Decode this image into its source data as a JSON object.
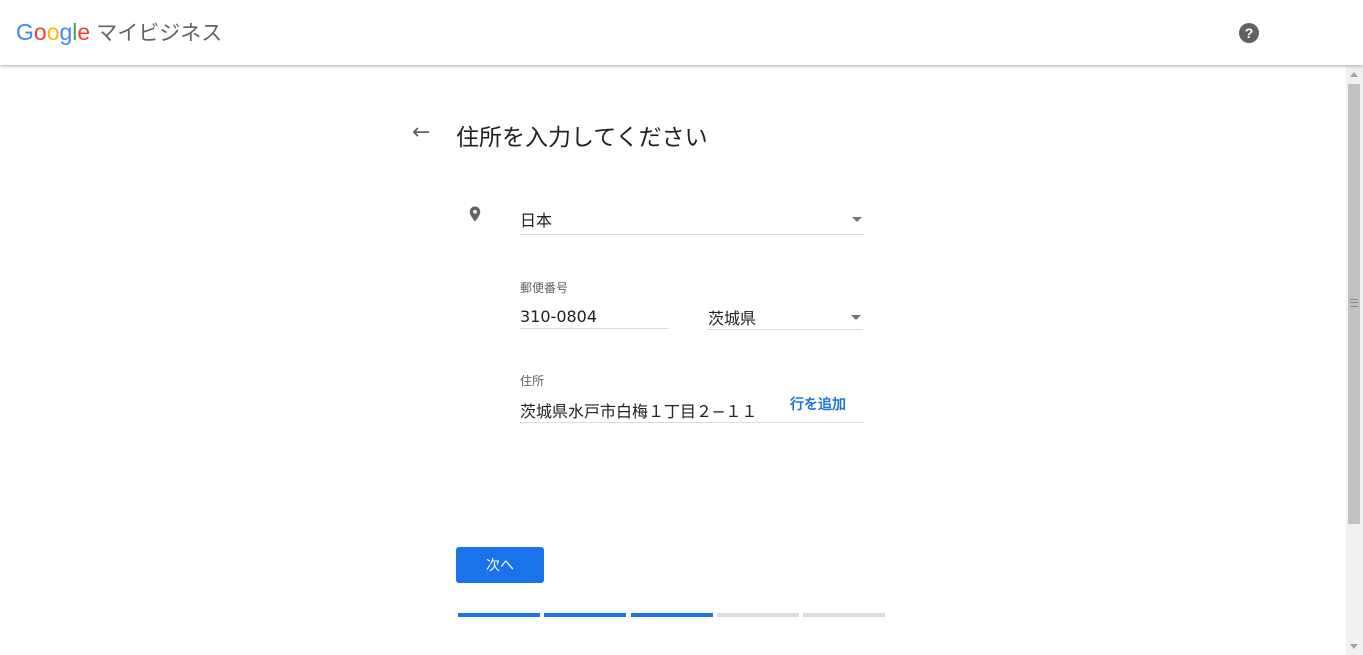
{
  "header": {
    "brand_letters": [
      {
        "ch": "G",
        "color": "#4285F4"
      },
      {
        "ch": "o",
        "color": "#EA4335"
      },
      {
        "ch": "o",
        "color": "#FBBC05"
      },
      {
        "ch": "g",
        "color": "#4285F4"
      },
      {
        "ch": "l",
        "color": "#34A853"
      },
      {
        "ch": "e",
        "color": "#EA4335"
      }
    ],
    "product": "マイビジネス",
    "help_glyph": "?"
  },
  "page": {
    "back_glyph": "←",
    "title": "住所を入力してください"
  },
  "form": {
    "country_value": "日本",
    "postal_label": "郵便番号",
    "postal_value": "310-0804",
    "prefecture_value": "茨城県",
    "address_label": "住所",
    "address_value": "茨城県水戸市白梅１丁目２−１１",
    "add_line_label": "行を追加"
  },
  "actions": {
    "next_label": "次へ"
  },
  "progress": {
    "total_steps": 5,
    "completed_steps": 3
  },
  "colors": {
    "accent": "#1a73e8",
    "step_inactive": "#dadce0"
  },
  "icons": {
    "back": "arrow-back-icon",
    "location": "location-pin-icon",
    "help": "help-icon",
    "dropdown": "dropdown-caret-icon"
  }
}
